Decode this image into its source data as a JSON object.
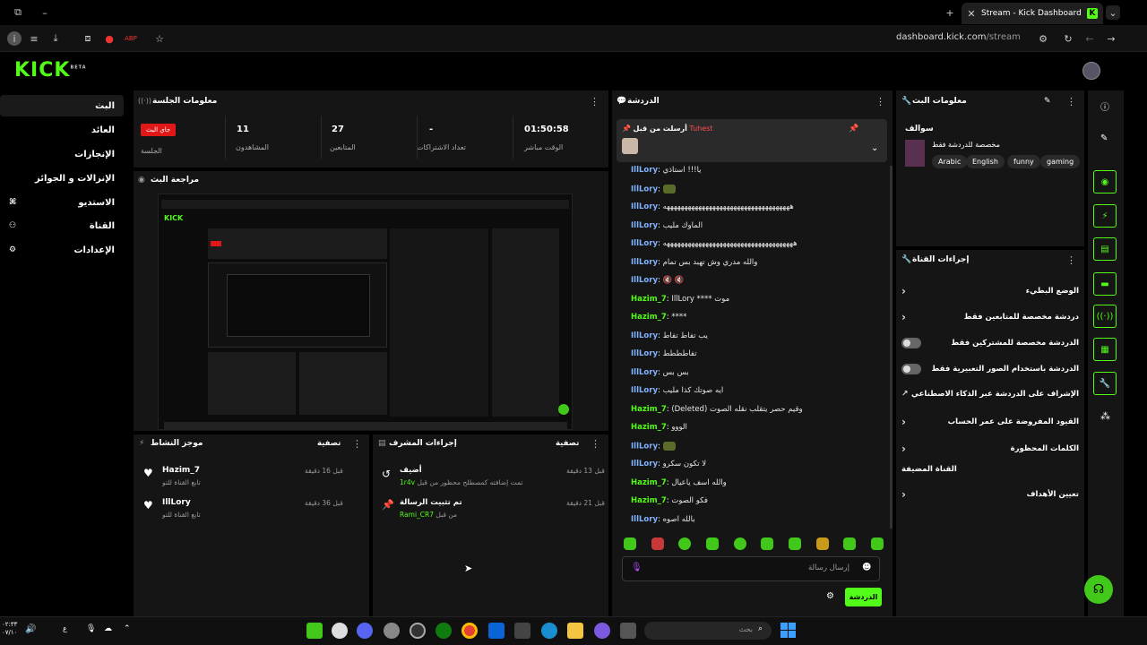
{
  "browser": {
    "tab_title": "Stream - Kick Dashboard",
    "url_host": "dashboard.kick.com",
    "url_path": "/stream"
  },
  "brand": {
    "logo": "KICK",
    "logo_sup": "BETA"
  },
  "nav": [
    {
      "label": "البث",
      "icon": ""
    },
    {
      "label": "العائد",
      "icon": ""
    },
    {
      "label": "الإنجازات",
      "icon": ""
    },
    {
      "label": "الإنزالات و الجوائز",
      "icon": ""
    },
    {
      "label": "الاستديو",
      "icon": "⌘"
    },
    {
      "label": "القناة",
      "icon": "⚇"
    },
    {
      "label": "الإعدادات",
      "icon": "⚙"
    }
  ],
  "session": {
    "title": "معلومات الجلسة",
    "stats": [
      {
        "value": "01:50:58",
        "label": "الوقت مباشر"
      },
      {
        "value": "-",
        "label": "تعداد الاشتراكات"
      },
      {
        "value": "27",
        "label": "المتابعين"
      },
      {
        "value": "11",
        "label": "المشاهدون"
      },
      {
        "value": "جاي البث",
        "label": "الجلسة"
      }
    ]
  },
  "preview": {
    "title": "مراجعة البث"
  },
  "activity": {
    "title": "موجز النشاط",
    "filter": "تصفية",
    "items": [
      {
        "user": "Hazim_7",
        "sub": "تابع القناة للتو",
        "time": "قبل 16 دقيقة"
      },
      {
        "user": "IllLory",
        "sub": "تابع القناة للتو",
        "time": "قبل 36 دقيقة"
      }
    ]
  },
  "mod_actions": {
    "title": "إجراءات المشرف",
    "filter": "تصفية",
    "items": [
      {
        "title": "أضيف",
        "sub_user": "1r4v",
        "sub": "تمت إضافته كمصطلح محظور من قبل",
        "time": "قبل 13 دقيقة",
        "icon": "↺"
      },
      {
        "title": "تم تثبيت الرسالة",
        "sub_user": "Rami_CR7",
        "sub": "من قبل",
        "time": "قبل 21 دقيقة",
        "icon": "📌"
      }
    ]
  },
  "chat": {
    "title": "الدردشة",
    "pinned_label": "أرسلت من قبل",
    "pinned_user": "Tuhest",
    "input_placeholder": "إرسال رسالة",
    "send_label": "الدردشة",
    "lines": [
      {
        "user": "IllLory",
        "color": "#7fb3ff",
        "text": "يا!!! استاذي"
      },
      {
        "user": "IllLory",
        "color": "#7fb3ff",
        "text": "",
        "emote": true
      },
      {
        "user": "IllLory",
        "color": "#7fb3ff",
        "text": "ههههههههههههههههههههههههههههههههههههه"
      },
      {
        "user": "IllLory",
        "color": "#7fb3ff",
        "text": "الماوك مليب"
      },
      {
        "user": "IllLory",
        "color": "#7fb3ff",
        "text": "هههههههههههههههههههههههههههههههههههههه"
      },
      {
        "user": "IllLory",
        "color": "#7fb3ff",
        "text": "والله مدري وش تهبد بس تمام"
      },
      {
        "user": "IllLory",
        "color": "#7fb3ff",
        "text": "🔇 🔇"
      },
      {
        "user": "Hazim_7",
        "color": "#53fc18",
        "text": "IllLory **** موت"
      },
      {
        "user": "Hazim_7",
        "color": "#53fc18",
        "text": "****"
      },
      {
        "user": "IllLory",
        "color": "#7fb3ff",
        "text": "يب تفاط تفاط"
      },
      {
        "user": "IllLory",
        "color": "#7fb3ff",
        "text": "تفاطططط"
      },
      {
        "user": "IllLory",
        "color": "#7fb3ff",
        "text": "بس بس"
      },
      {
        "user": "IllLory",
        "color": "#7fb3ff",
        "text": "ايه صوتك كذا مليب"
      },
      {
        "user": "Hazim_7",
        "color": "#53fc18",
        "text": "(Deleted) وقيم حصر يتقلب نقله الصوت"
      },
      {
        "user": "Hazim_7",
        "color": "#53fc18",
        "text": "الووو"
      },
      {
        "user": "IllLory",
        "color": "#7fb3ff",
        "text": "",
        "emote": true
      },
      {
        "user": "IllLory",
        "color": "#7fb3ff",
        "text": "لا تكون سكرو"
      },
      {
        "user": "Hazim_7",
        "color": "#53fc18",
        "text": "والله اسف ياعيال"
      },
      {
        "user": "Hazim_7",
        "color": "#53fc18",
        "text": "فكو الصوت"
      },
      {
        "user": "IllLory",
        "color": "#7fb3ff",
        "text": "بالله اصوه"
      }
    ]
  },
  "stream_info": {
    "title": "معلومات البث",
    "stream_title": "سوالف",
    "category": "مخصصة للدردشة فقط",
    "tags": [
      "Arabic",
      "English",
      "funny",
      "gaming"
    ]
  },
  "channel_actions": {
    "title": "إجراءات القناة",
    "rows": [
      {
        "label": "الوضع البطيء",
        "kind": "chevron"
      },
      {
        "label": "دردشة مخصصة للمتابعين فقط",
        "kind": "chevron"
      },
      {
        "label": "الدردشة مخصصة للمشتركين فقط",
        "kind": "toggle"
      },
      {
        "label": "الدردشة باستخدام الصور التعبيرية فقط",
        "kind": "toggle"
      },
      {
        "label": "الإشراف على الدردشة عبر الذكاء الاصطناعي",
        "kind": "link"
      },
      {
        "label": "القيود المفروضة على عمر الحساب",
        "kind": "chevron"
      },
      {
        "label": "الكلمات المحظورة",
        "kind": "chevron"
      },
      {
        "label": "القناة المضيفة",
        "kind": "none"
      },
      {
        "label": "تعيين الأهداف",
        "kind": "chevron"
      }
    ]
  },
  "taskbar": {
    "search_placeholder": "بحث",
    "clock_time": "٠٢:٣٣",
    "clock_date": "٠٧/١٠"
  }
}
